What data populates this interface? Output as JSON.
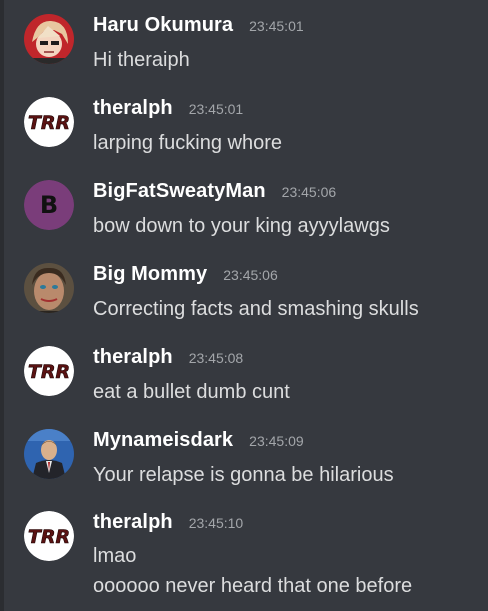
{
  "colors": {
    "background": "#36393f",
    "author": "#ffffff",
    "message_text": "#dcddde",
    "timestamp": "#a3a6aa"
  },
  "messages": [
    {
      "author": "Haru Okumura",
      "time": "23:45:01",
      "avatar_icon": "anime-girl-avatar-icon",
      "lines": [
        "Hi theraiph"
      ]
    },
    {
      "author": "theralph",
      "time": "23:45:01",
      "avatar_icon": "trr-logo-avatar-icon",
      "avatar_text": "TRR",
      "lines": [
        "larping fucking whore"
      ]
    },
    {
      "author": "BigFatSweatyMan",
      "time": "23:45:06",
      "avatar_icon": "letter-b-avatar-icon",
      "avatar_text": "B",
      "lines": [
        "bow down to your king ayyylawgs"
      ]
    },
    {
      "author": "Big Mommy",
      "time": "23:45:06",
      "avatar_icon": "face-photo-avatar-icon",
      "lines": [
        "Correcting facts and smashing skulls"
      ]
    },
    {
      "author": "theralph",
      "time": "23:45:08",
      "avatar_icon": "trr-logo-avatar-icon",
      "avatar_text": "TRR",
      "lines": [
        "eat a bullet dumb cunt"
      ]
    },
    {
      "author": "Mynameisdark",
      "time": "23:45:09",
      "avatar_icon": "person-photo-avatar-icon",
      "lines": [
        "Your relapse is gonna be hilarious"
      ]
    },
    {
      "author": "theralph",
      "time": "23:45:10",
      "avatar_icon": "trr-logo-avatar-icon",
      "avatar_text": "TRR",
      "lines": [
        "lmao",
        "oooooo never heard that one before"
      ]
    }
  ]
}
